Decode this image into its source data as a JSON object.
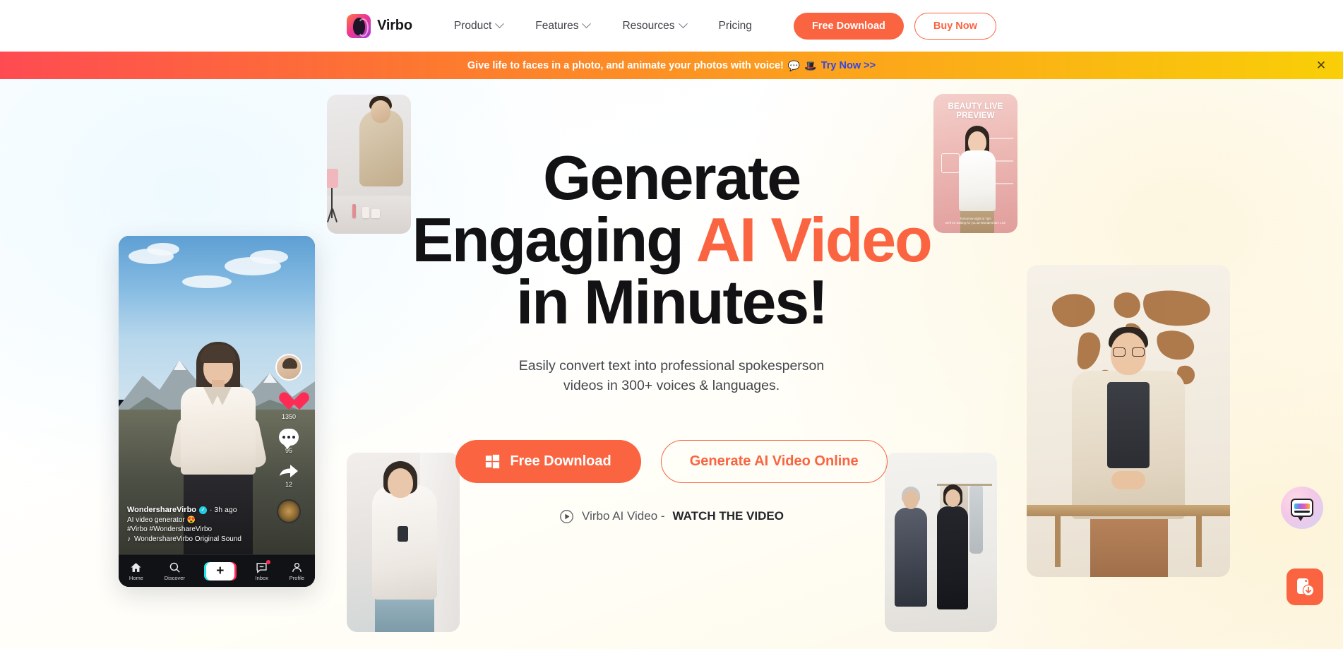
{
  "nav": {
    "brand": "Virbo",
    "logo_icon": "virbo-logo-icon",
    "links": [
      {
        "label": "Product",
        "has_caret": true
      },
      {
        "label": "Features",
        "has_caret": true
      },
      {
        "label": "Resources",
        "has_caret": true
      },
      {
        "label": "Pricing",
        "has_caret": false
      }
    ],
    "free_download": "Free Download",
    "buy_now": "Buy Now"
  },
  "banner": {
    "text": "Give life to faces in a photo, and animate your photos with voice!",
    "emoji1": "💬",
    "emoji2": "🎩",
    "link": "Try Now >>",
    "close_icon": "close-icon",
    "gradient_start": "#FE4B52",
    "gradient_mid": "#FCA31C",
    "gradient_end": "#F9CF07",
    "link_color": "#3246E8"
  },
  "hero": {
    "line1": "Generate",
    "line2_plain": "Engaging ",
    "line2_accent": "AI Video",
    "line3": "in Minutes!",
    "accent_color": "#FA6440",
    "subtitle_line1": "Easily convert text into professional spokesperson",
    "subtitle_line2": "videos in 300+ voices & languages.",
    "cta_primary": "Free Download",
    "cta_primary_icon": "windows-icon",
    "cta_secondary": "Generate AI Video Online",
    "watch_icon": "play-circle-icon",
    "watch_prefix": "Virbo AI Video - ",
    "watch_strong": "WATCH THE VIDEO"
  },
  "phone_mockup": {
    "username": "WondershareVirbo",
    "verified_icon": "verified-badge-icon",
    "timestamp": "· 3h ago",
    "description": "AI video generator",
    "description_emoji": "😍",
    "hashtags": "#Virbo #WondershareVirbo",
    "sound_icon": "music-note-icon",
    "sound": "WondershareVirbo Original Sound",
    "actions": [
      {
        "icon": "avatar-icon",
        "count": ""
      },
      {
        "icon": "heart-icon",
        "count": "1350"
      },
      {
        "icon": "comment-icon",
        "count": "95"
      },
      {
        "icon": "share-icon",
        "count": "12"
      },
      {
        "icon": "sound-disc-icon",
        "count": ""
      }
    ],
    "tabbar": [
      {
        "icon": "home-icon",
        "label": "Home"
      },
      {
        "icon": "search-icon",
        "label": "Discover"
      },
      {
        "icon": "plus-icon",
        "label": ""
      },
      {
        "icon": "inbox-icon",
        "label": "Inbox"
      },
      {
        "icon": "profile-icon",
        "label": "Profile"
      }
    ]
  },
  "beauty_card": {
    "title_line1": "BEAUTY LIVE",
    "title_line2": "PREVIEW",
    "footnote_line1": "Tomorrow night at 7pm",
    "footnote_line2": "we'll be waiting for you at Wondershare Live"
  },
  "widgets": {
    "chat_icon": "chat-bubble-icon",
    "app_icon": "app-download-icon",
    "app_color": "#FA6440"
  }
}
